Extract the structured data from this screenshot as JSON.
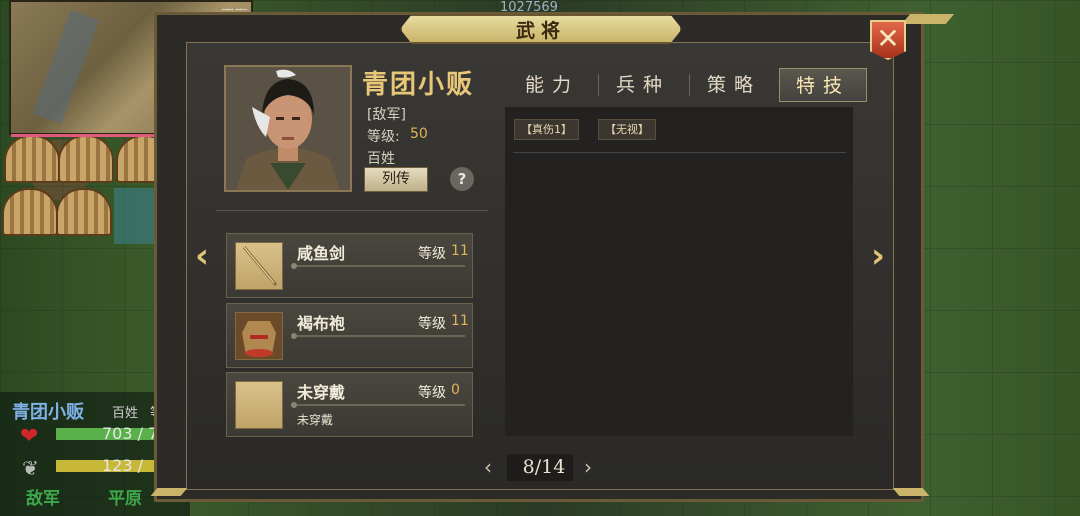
{
  "window": {
    "title": "武将"
  },
  "background": {
    "top_counter": "1027569",
    "minimap_label": "ꟷꟷ ꟷꟷ"
  },
  "unit_info": {
    "name": "青团小贩",
    "class": "百姓",
    "level_label": "等级",
    "hp": "703 / 7",
    "mp": "123 /",
    "faction": "敌军",
    "terrain": "平原"
  },
  "hero": {
    "name": "青团小贩",
    "faction": "[敌军]",
    "level_label": "等级:",
    "level_value": "50",
    "class": "百姓",
    "bio_button": "列传",
    "help_button": "?"
  },
  "tabs": [
    {
      "label": "能力",
      "active": false
    },
    {
      "label": "兵种",
      "active": false
    },
    {
      "label": "策略",
      "active": false
    },
    {
      "label": "特技",
      "active": true
    }
  ],
  "skills": [
    "【真伤1】",
    "【无视】"
  ],
  "equipment": [
    {
      "name": "咸鱼剑",
      "level_label": "等级",
      "level_value": "11",
      "note": "",
      "icon": "sword-icon"
    },
    {
      "name": "褐布袍",
      "level_label": "等级",
      "level_value": "11",
      "note": "",
      "icon": "robe-icon"
    },
    {
      "name": "未穿戴",
      "level_label": "等级",
      "level_value": "0",
      "note": "未穿戴",
      "icon": "empty-slot-icon"
    }
  ],
  "pager": {
    "current": "8/14",
    "prev": "‹",
    "next": "›"
  },
  "nav": {
    "prev": "‹",
    "next": "›"
  },
  "close_label": "✕",
  "colors": {
    "gold": "#e2b45a",
    "name_gold": "#e8c878",
    "unit_name_blue": "#7fb0e6",
    "faction_green": "#3ea84a"
  }
}
